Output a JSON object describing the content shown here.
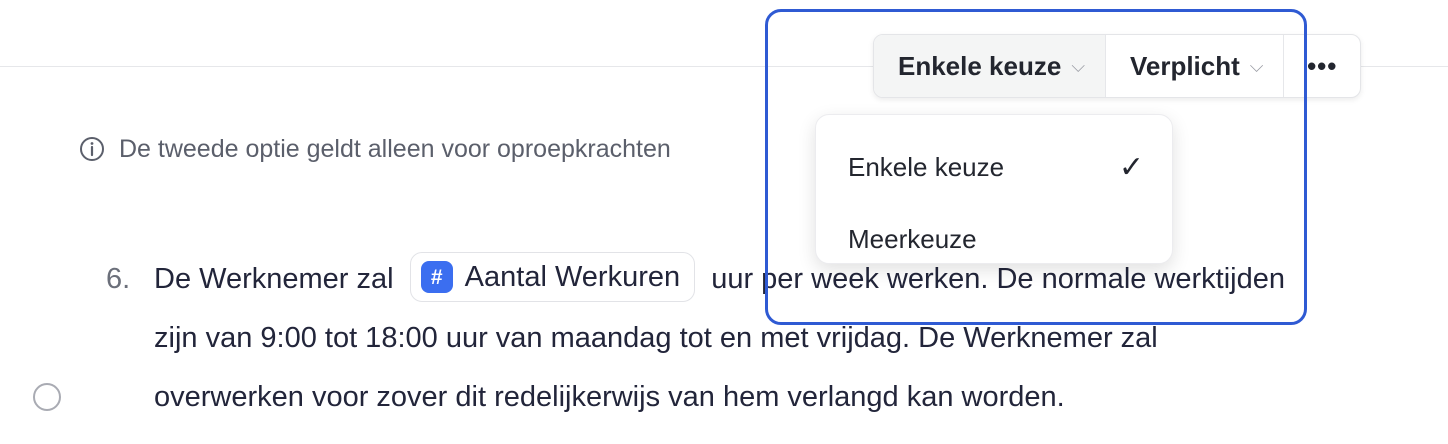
{
  "info_note": {
    "text": "De tweede optie geldt alleen voor oproepkrachten",
    "icon": "info-icon"
  },
  "clause": {
    "number": "6.",
    "text_before": "De Werknemer zal",
    "variable": {
      "icon": "#",
      "label": "Aantal Werkuren"
    },
    "text_after": "uur per week werken. De normale werktijden zijn van 9:00 tot 18:00 uur van maandag tot en met vrijdag. De Werknemer zal overwerken voor zover dit redelijkerwijs van hem verlangd kan worden."
  },
  "toolbar": {
    "type_label": "Enkele keuze",
    "required_label": "Verplicht",
    "more_label": "•••"
  },
  "dropdown": {
    "items": [
      {
        "label": "Enkele keuze",
        "selected": true,
        "check": "✓"
      },
      {
        "label": "Meerkeuze",
        "selected": false
      }
    ]
  },
  "colors": {
    "accent": "#3b6ef0",
    "highlight_border": "#2f5ad3"
  }
}
